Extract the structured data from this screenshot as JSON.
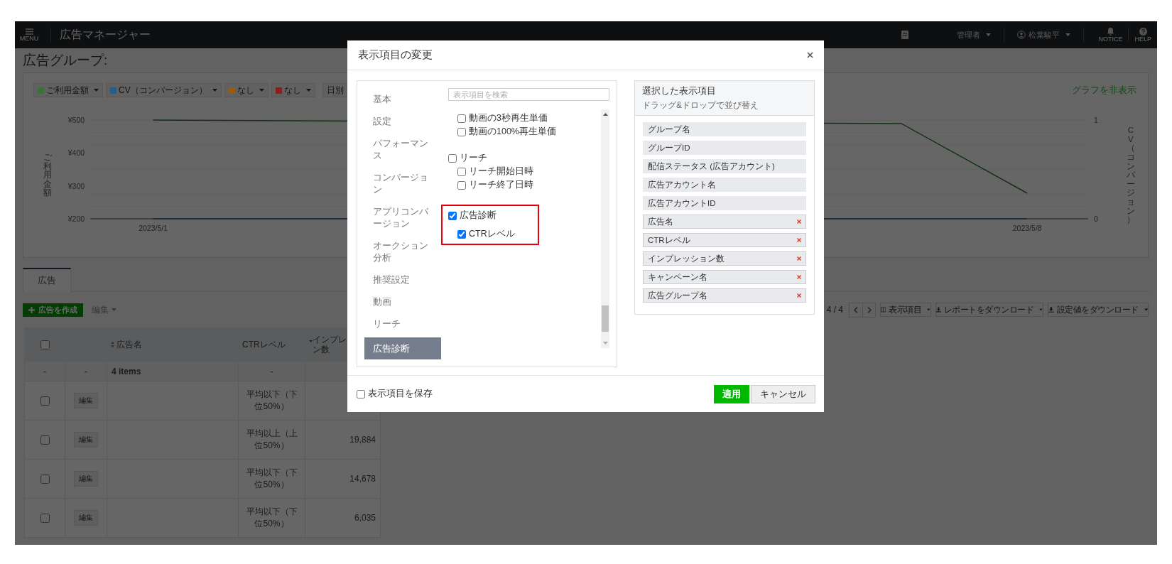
{
  "header": {
    "menu_label": "MENU",
    "app_title": "広告マネージャー",
    "role": "管理者",
    "user": "松葉駿平",
    "notice_label": "NOTICE",
    "help_label": "HELP"
  },
  "page": {
    "title": "広告グループ:"
  },
  "chart": {
    "legend": [
      {
        "label": "ご利用金額",
        "color": "#2f7a2f"
      },
      {
        "label": "CV（コンバージョン）",
        "color": "#1f5f99"
      },
      {
        "label": "なし",
        "color": "#9a5a12"
      },
      {
        "label": "なし",
        "color": "#8a1f22"
      }
    ],
    "period": "日別",
    "toggle_link": "グラフを非表示",
    "left_axis_label": "ご利用金額",
    "right_axis_label": "CV（コンバージョン）",
    "left_ticks": [
      "¥500",
      "¥400",
      "¥300",
      "¥200"
    ],
    "right_ticks": [
      "1",
      "0"
    ],
    "x_labels": [
      "2023/5/1",
      "2023/5/8"
    ]
  },
  "tabs": [
    {
      "label": "広告",
      "selected": true
    }
  ],
  "toolbar": {
    "create_button": "広告を作成",
    "edit_button": {
      "label": "編集",
      "disabled": true
    },
    "page_count": "4 / 4",
    "columns_button": "表示項目",
    "report_button": "レポートをダウンロード",
    "settings_button": "設定値をダウンロード"
  },
  "table": {
    "select_all": {
      "checked": false
    },
    "columns": [
      {
        "label": "広告名",
        "kind": "sortable"
      },
      {
        "label": "CTRレベル",
        "kind": "plain"
      },
      {
        "label": "インプレ",
        "label_second_line": "ン数",
        "kind": "sorted"
      }
    ],
    "summary": [
      "-",
      "-",
      "4 items",
      "-"
    ],
    "rows": [
      {
        "checked": false,
        "edit": "編集",
        "ctr": "平均以下（下位50%）"
      },
      {
        "checked": false,
        "edit": "編集",
        "ctr": "平均以上（上位50%）",
        "impressions": "19,884"
      },
      {
        "checked": false,
        "edit": "編集",
        "ctr": "平均以下（下位50%）",
        "impressions": "14,678"
      },
      {
        "checked": false,
        "edit": "編集",
        "ctr": "平均以下（下位50%）",
        "impressions": "6,035"
      }
    ]
  },
  "modal": {
    "title": "表示項目の変更",
    "categories": [
      {
        "label": "基本",
        "selected": false
      },
      {
        "label": "設定",
        "selected": false
      },
      {
        "label": "パフォーマンス",
        "selected": false
      },
      {
        "label": "コンバージョン",
        "selected": false
      },
      {
        "label": "アプリコンバージョン",
        "selected": false
      },
      {
        "label": "オークション分析",
        "selected": false
      },
      {
        "label": "推奨設定",
        "selected": false
      },
      {
        "label": "動画",
        "selected": false
      },
      {
        "label": "リーチ",
        "selected": false
      },
      {
        "label": "広告診断",
        "selected": true
      }
    ],
    "search_placeholder": "表示項目を検索",
    "groups": [
      {
        "children": [
          {
            "label": "動画の3秒再生単価",
            "checked": false
          },
          {
            "label": "動画の100%再生単価",
            "checked": false
          }
        ]
      },
      {
        "label": "リーチ",
        "checked": false,
        "highlighted": false,
        "children": [
          {
            "label": "リーチ開始日時",
            "checked": false
          },
          {
            "label": "リーチ終了日時",
            "checked": false
          }
        ]
      },
      {
        "label": "広告診断",
        "checked": true,
        "highlighted": true,
        "children": [
          {
            "label": "CTRレベル",
            "checked": true
          }
        ]
      }
    ],
    "selected_panel": {
      "title": "選択した表示項目",
      "hint": "ドラッグ&ドロップで並び替え",
      "items": [
        {
          "label": "グループ名",
          "removable": false
        },
        {
          "label": "グループID",
          "removable": false
        },
        {
          "label": "配信ステータス (広告アカウント)",
          "removable": false
        },
        {
          "label": "広告アカウント名",
          "removable": false
        },
        {
          "label": "広告アカウントID",
          "removable": false
        },
        {
          "label": "広告名",
          "removable": true
        },
        {
          "label": "CTRレベル",
          "removable": true
        },
        {
          "label": "インプレッション数",
          "removable": true
        },
        {
          "label": "キャンペーン名",
          "removable": true
        },
        {
          "label": "広告グループ名",
          "removable": true
        }
      ]
    },
    "save_checkbox": {
      "label": "表示項目を保存",
      "checked": false
    },
    "apply_button": "適用",
    "cancel_button": "キャンセル"
  }
}
